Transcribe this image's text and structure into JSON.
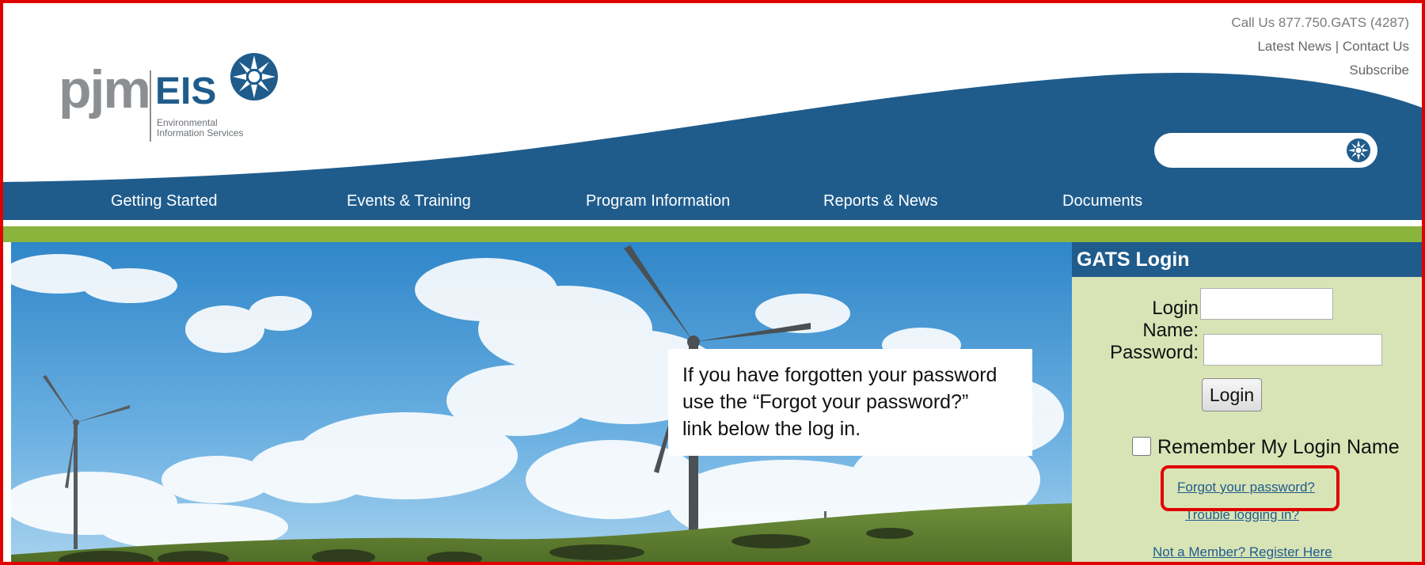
{
  "header": {
    "logo": {
      "name": "pjm",
      "product": "EIS",
      "subtitle_line1": "Environmental",
      "subtitle_line2": "Information Services"
    },
    "call_us": "Call Us 877.750.GATS (4287)",
    "latest_news": "Latest News",
    "separator": "|",
    "contact_us": "Contact Us",
    "subscribe": "Subscribe",
    "search": {
      "placeholder": "",
      "value": ""
    }
  },
  "nav": {
    "items": [
      {
        "label": "Getting Started"
      },
      {
        "label": "Events & Training"
      },
      {
        "label": "Program Information"
      },
      {
        "label": "Reports & News"
      },
      {
        "label": "Documents"
      }
    ]
  },
  "callout": {
    "line1": "If you have forgotten your password",
    "line2": "use the “Forgot your password?”",
    "line3": "link below the log in."
  },
  "login": {
    "title": "GATS Login",
    "login_name_label": "Login Name:",
    "login_name_value": "",
    "password_label": "Password:",
    "password_value": "",
    "login_button": "Login",
    "remember_label": "Remember My Login Name",
    "remember_checked": false,
    "forgot_link": "Forgot your password?",
    "trouble_link": "Trouble logging in?",
    "register_link": "Not a Member? Register Here"
  },
  "colors": {
    "brand_blue": "#1f5c8c",
    "accent_green": "#8ab43c",
    "login_panel_bg": "#d9e4b6",
    "highlight_red": "#e00000"
  }
}
